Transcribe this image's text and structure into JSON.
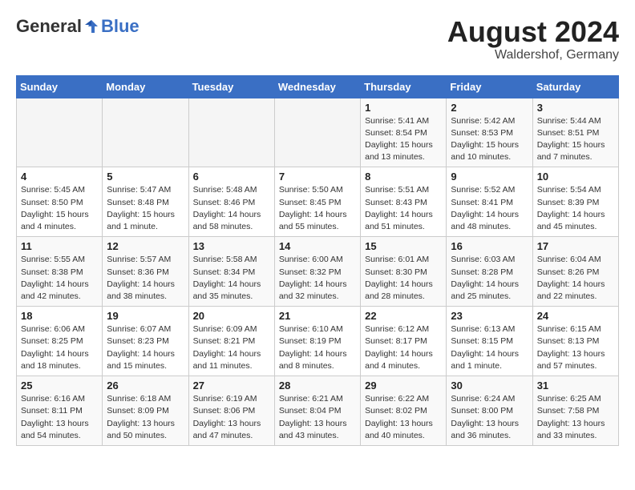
{
  "header": {
    "logo_general": "General",
    "logo_blue": "Blue",
    "month": "August 2024",
    "location": "Waldershof, Germany"
  },
  "weekdays": [
    "Sunday",
    "Monday",
    "Tuesday",
    "Wednesday",
    "Thursday",
    "Friday",
    "Saturday"
  ],
  "weeks": [
    [
      {
        "day": "",
        "sunrise": "",
        "sunset": "",
        "daylight": ""
      },
      {
        "day": "",
        "sunrise": "",
        "sunset": "",
        "daylight": ""
      },
      {
        "day": "",
        "sunrise": "",
        "sunset": "",
        "daylight": ""
      },
      {
        "day": "",
        "sunrise": "",
        "sunset": "",
        "daylight": ""
      },
      {
        "day": "1",
        "sunrise": "Sunrise: 5:41 AM",
        "sunset": "Sunset: 8:54 PM",
        "daylight": "Daylight: 15 hours and 13 minutes."
      },
      {
        "day": "2",
        "sunrise": "Sunrise: 5:42 AM",
        "sunset": "Sunset: 8:53 PM",
        "daylight": "Daylight: 15 hours and 10 minutes."
      },
      {
        "day": "3",
        "sunrise": "Sunrise: 5:44 AM",
        "sunset": "Sunset: 8:51 PM",
        "daylight": "Daylight: 15 hours and 7 minutes."
      }
    ],
    [
      {
        "day": "4",
        "sunrise": "Sunrise: 5:45 AM",
        "sunset": "Sunset: 8:50 PM",
        "daylight": "Daylight: 15 hours and 4 minutes."
      },
      {
        "day": "5",
        "sunrise": "Sunrise: 5:47 AM",
        "sunset": "Sunset: 8:48 PM",
        "daylight": "Daylight: 15 hours and 1 minute."
      },
      {
        "day": "6",
        "sunrise": "Sunrise: 5:48 AM",
        "sunset": "Sunset: 8:46 PM",
        "daylight": "Daylight: 14 hours and 58 minutes."
      },
      {
        "day": "7",
        "sunrise": "Sunrise: 5:50 AM",
        "sunset": "Sunset: 8:45 PM",
        "daylight": "Daylight: 14 hours and 55 minutes."
      },
      {
        "day": "8",
        "sunrise": "Sunrise: 5:51 AM",
        "sunset": "Sunset: 8:43 PM",
        "daylight": "Daylight: 14 hours and 51 minutes."
      },
      {
        "day": "9",
        "sunrise": "Sunrise: 5:52 AM",
        "sunset": "Sunset: 8:41 PM",
        "daylight": "Daylight: 14 hours and 48 minutes."
      },
      {
        "day": "10",
        "sunrise": "Sunrise: 5:54 AM",
        "sunset": "Sunset: 8:39 PM",
        "daylight": "Daylight: 14 hours and 45 minutes."
      }
    ],
    [
      {
        "day": "11",
        "sunrise": "Sunrise: 5:55 AM",
        "sunset": "Sunset: 8:38 PM",
        "daylight": "Daylight: 14 hours and 42 minutes."
      },
      {
        "day": "12",
        "sunrise": "Sunrise: 5:57 AM",
        "sunset": "Sunset: 8:36 PM",
        "daylight": "Daylight: 14 hours and 38 minutes."
      },
      {
        "day": "13",
        "sunrise": "Sunrise: 5:58 AM",
        "sunset": "Sunset: 8:34 PM",
        "daylight": "Daylight: 14 hours and 35 minutes."
      },
      {
        "day": "14",
        "sunrise": "Sunrise: 6:00 AM",
        "sunset": "Sunset: 8:32 PM",
        "daylight": "Daylight: 14 hours and 32 minutes."
      },
      {
        "day": "15",
        "sunrise": "Sunrise: 6:01 AM",
        "sunset": "Sunset: 8:30 PM",
        "daylight": "Daylight: 14 hours and 28 minutes."
      },
      {
        "day": "16",
        "sunrise": "Sunrise: 6:03 AM",
        "sunset": "Sunset: 8:28 PM",
        "daylight": "Daylight: 14 hours and 25 minutes."
      },
      {
        "day": "17",
        "sunrise": "Sunrise: 6:04 AM",
        "sunset": "Sunset: 8:26 PM",
        "daylight": "Daylight: 14 hours and 22 minutes."
      }
    ],
    [
      {
        "day": "18",
        "sunrise": "Sunrise: 6:06 AM",
        "sunset": "Sunset: 8:25 PM",
        "daylight": "Daylight: 14 hours and 18 minutes."
      },
      {
        "day": "19",
        "sunrise": "Sunrise: 6:07 AM",
        "sunset": "Sunset: 8:23 PM",
        "daylight": "Daylight: 14 hours and 15 minutes."
      },
      {
        "day": "20",
        "sunrise": "Sunrise: 6:09 AM",
        "sunset": "Sunset: 8:21 PM",
        "daylight": "Daylight: 14 hours and 11 minutes."
      },
      {
        "day": "21",
        "sunrise": "Sunrise: 6:10 AM",
        "sunset": "Sunset: 8:19 PM",
        "daylight": "Daylight: 14 hours and 8 minutes."
      },
      {
        "day": "22",
        "sunrise": "Sunrise: 6:12 AM",
        "sunset": "Sunset: 8:17 PM",
        "daylight": "Daylight: 14 hours and 4 minutes."
      },
      {
        "day": "23",
        "sunrise": "Sunrise: 6:13 AM",
        "sunset": "Sunset: 8:15 PM",
        "daylight": "Daylight: 14 hours and 1 minute."
      },
      {
        "day": "24",
        "sunrise": "Sunrise: 6:15 AM",
        "sunset": "Sunset: 8:13 PM",
        "daylight": "Daylight: 13 hours and 57 minutes."
      }
    ],
    [
      {
        "day": "25",
        "sunrise": "Sunrise: 6:16 AM",
        "sunset": "Sunset: 8:11 PM",
        "daylight": "Daylight: 13 hours and 54 minutes."
      },
      {
        "day": "26",
        "sunrise": "Sunrise: 6:18 AM",
        "sunset": "Sunset: 8:09 PM",
        "daylight": "Daylight: 13 hours and 50 minutes."
      },
      {
        "day": "27",
        "sunrise": "Sunrise: 6:19 AM",
        "sunset": "Sunset: 8:06 PM",
        "daylight": "Daylight: 13 hours and 47 minutes."
      },
      {
        "day": "28",
        "sunrise": "Sunrise: 6:21 AM",
        "sunset": "Sunset: 8:04 PM",
        "daylight": "Daylight: 13 hours and 43 minutes."
      },
      {
        "day": "29",
        "sunrise": "Sunrise: 6:22 AM",
        "sunset": "Sunset: 8:02 PM",
        "daylight": "Daylight: 13 hours and 40 minutes."
      },
      {
        "day": "30",
        "sunrise": "Sunrise: 6:24 AM",
        "sunset": "Sunset: 8:00 PM",
        "daylight": "Daylight: 13 hours and 36 minutes."
      },
      {
        "day": "31",
        "sunrise": "Sunrise: 6:25 AM",
        "sunset": "Sunset: 7:58 PM",
        "daylight": "Daylight: 13 hours and 33 minutes."
      }
    ]
  ]
}
